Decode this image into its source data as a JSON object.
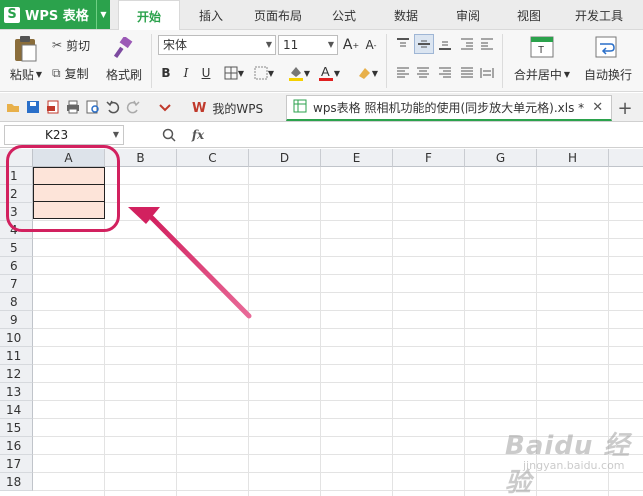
{
  "app": {
    "name": "WPS 表格",
    "logo_letter": "S"
  },
  "menu_tabs": [
    "开始",
    "插入",
    "页面布局",
    "公式",
    "数据",
    "审阅",
    "视图",
    "开发工具"
  ],
  "ribbon": {
    "paste": "粘贴",
    "cut": "剪切",
    "copy": "复制",
    "format_painter": "格式刷",
    "font_name": "宋体",
    "font_size": "11",
    "bold": "B",
    "italic": "I",
    "underline": "U",
    "merge_center": "合并居中",
    "wrap_text": "自动换行"
  },
  "doc_tabs": [
    {
      "label": "我的WPS"
    },
    {
      "label": "wps表格 照相机功能的使用(同步放大单元格).xls *"
    }
  ],
  "formula_bar": {
    "cell_ref": "K23",
    "fx": "fx"
  },
  "columns": [
    "A",
    "B",
    "C",
    "D",
    "E",
    "F",
    "G",
    "H"
  ],
  "rows": [
    "1",
    "2",
    "3",
    "4",
    "5",
    "6",
    "7",
    "8",
    "9",
    "10",
    "11",
    "12",
    "13",
    "14",
    "15",
    "16",
    "17",
    "18"
  ],
  "watermark": {
    "main": "Baidu 经验",
    "sub": "jingyan.baidu.com"
  },
  "colors": {
    "accent": "#2ba24c",
    "highlight": "#d2215f",
    "selected_fill": "#fde4d9"
  }
}
